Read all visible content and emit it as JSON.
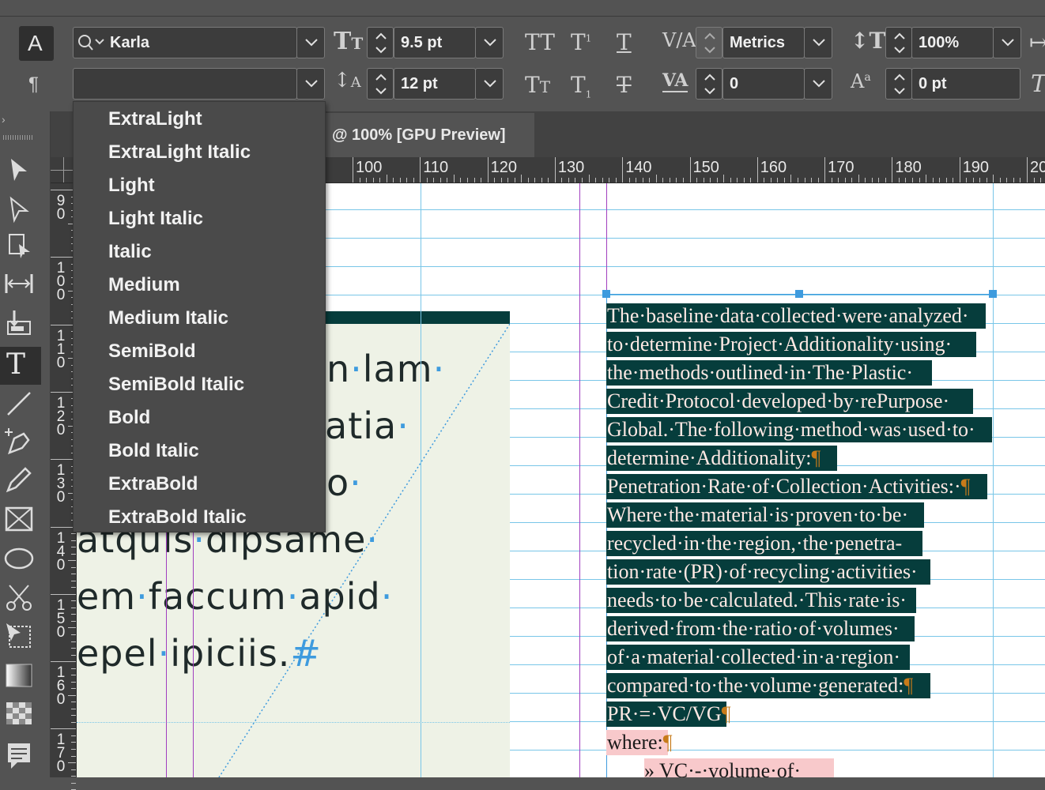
{
  "control_bar": {
    "font_family": "Karla",
    "font_style": "",
    "font_size": "9.5 pt",
    "leading": "12 pt",
    "kerning": "Metrics",
    "tracking": "0",
    "vertical_scale": "100%",
    "baseline_shift": "0 pt"
  },
  "font_style_menu": {
    "items": [
      "ExtraLight",
      "ExtraLight Italic",
      "Light",
      "Light Italic",
      "Italic",
      "Medium",
      "Medium Italic",
      "SemiBold",
      "SemiBold Italic",
      "Bold",
      "Bold Italic",
      "ExtraBold",
      "ExtraBold Italic"
    ]
  },
  "document": {
    "tab_title": "@ 100% [GPU Preview]"
  },
  "rulers": {
    "horizontal": [
      "100",
      "110",
      "120",
      "130",
      "140",
      "150",
      "160",
      "170",
      "180",
      "190",
      "20"
    ],
    "vertical": [
      "90",
      "100",
      "110",
      "120",
      "130",
      "140",
      "150",
      "160",
      "170"
    ]
  },
  "left_frame": {
    "lines": [
      "n·lam·",
      "atia·",
      "o·",
      "atquis·dipsame·",
      "em·faccum·apid·",
      "epel·ipiciis.#"
    ]
  },
  "text_frame": {
    "lines": [
      "The·baseline·data·collected·were·analyzed·",
      "to·determine·Project·Additionality·using·",
      "the·methods·outlined·in·The·Plastic·",
      "Credit·Protocol·developed·by·rePurpose·",
      "Global.·The·following·method·was·used·to·",
      "determine·Additionality:¶",
      "Penetration·Rate·of·Collection·Activities:·¶",
      "Where·the·material·is·proven·to·be·",
      "recycled·in·the·region,·the·penetra-",
      "tion·rate·(PR)·of·recycling·activities·",
      "needs·to·be·calculated.·This·rate·is·",
      "derived·from·the·ratio·of·volumes·",
      "of·a·material·collected·in·a·region·",
      "compared·to·the·volume·generated:¶",
      "PR·=·VC/VG¶",
      "where:¶",
      "»  VC·-·volume·of·"
    ]
  },
  "colors": {
    "highlight": "#063d3c",
    "guide": "#79c6e8",
    "margin_guide": "#a13fbf",
    "pink_highlight": "#f8c9cb"
  }
}
